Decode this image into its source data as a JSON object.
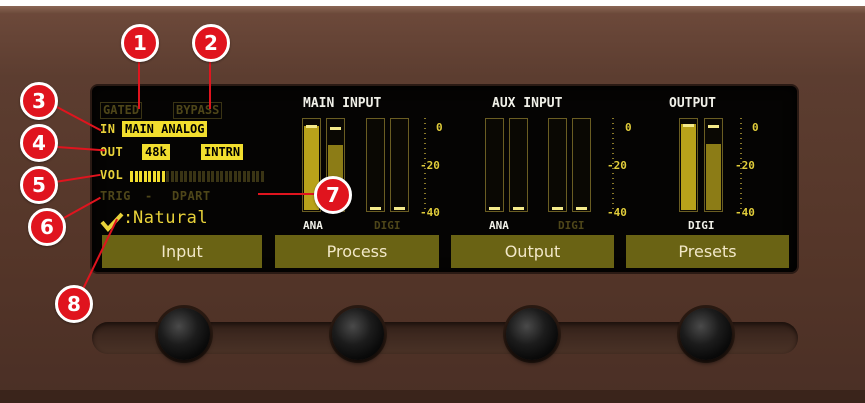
{
  "status": {
    "gated": "GATED",
    "bypass": "BYPASS",
    "in_label": "IN",
    "in_value": "MAIN ANALOG",
    "out_label": "OUT",
    "out_rate": "48k",
    "out_clock": "INTRN",
    "vol_label": "VOL",
    "vol_level": 0.25,
    "trig": "TRIG",
    "dpart": "DPART",
    "check_icon": "check-icon",
    "preset_prefix": ":",
    "preset_name": "Natural"
  },
  "meters": [
    {
      "title": "MAIN INPUT",
      "left_label": "ANA",
      "right_label": "DIGI",
      "active": "ANA"
    },
    {
      "title": "AUX INPUT",
      "left_label": "ANA",
      "right_label": "DIGI",
      "active": "ANA"
    },
    {
      "title": "OUTPUT",
      "left_label": "DIGI",
      "active": "DIGI"
    }
  ],
  "scale": {
    "top": "0",
    "mid": "-20",
    "bottom": "-40"
  },
  "tabs": [
    "Input",
    "Process",
    "Output",
    "Presets"
  ],
  "callouts": [
    "1",
    "2",
    "3",
    "4",
    "5",
    "6",
    "7",
    "8"
  ],
  "colors": {
    "lcd": "#e8d23a",
    "panel": "#5c3d30",
    "callout": "#e0141e"
  }
}
